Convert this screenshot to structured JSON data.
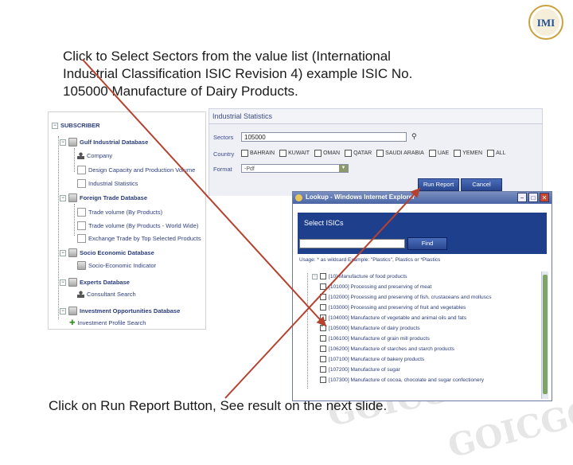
{
  "logo": {
    "text": "IMI"
  },
  "instructions": {
    "top": "Click to Select Sectors from the value list (International Industrial Classification ISIC Revision 4) example ISIC No. 105000 Manufacture of Dairy Products.",
    "bottom": "Click on Run Report Button,  See result on the next slide."
  },
  "watermark": {
    "text": "GOICGOICG"
  },
  "left_panel": {
    "subscriber": "SUBSCRIBER",
    "gulf_industrial": "Gulf Industrial Database",
    "company": "Company",
    "design_capacity": "Design Capacity and Production Volume",
    "industrial_statistics": "Industrial Statistics",
    "foreign_trade": "Foreign Trade Database",
    "trade_volume_products": "Trade volume (By Products)",
    "trade_volume_worldwide": "Trade volume (By Products - World Wide)",
    "exchange_trade": "Exchange Trade by Top Selected Products",
    "socio_economic": "Socio Economic Database",
    "socio_indicator": "Socio-Economic Indicator",
    "experts": "Experts Database",
    "consultant_search": "Consultant Search",
    "investment": "Investment Opportunities Database",
    "investment_profile": "Investment Profile Search"
  },
  "main_panel": {
    "title": "Industrial Statistics",
    "sectors_label": "Sectors",
    "sectors_value": "105000",
    "country_label": "Country",
    "countries": [
      "BAHRAIN",
      "KUWAIT",
      "OMAN",
      "QATAR",
      "SAUDI ARABIA",
      "UAE",
      "YEMEN",
      "ALL"
    ],
    "format_label": "Format",
    "format_value": "-Pdf",
    "run_report": "Run Report",
    "cancel": "Cancel"
  },
  "lookup": {
    "window_title": "Lookup - Windows Internet Explorer",
    "header_title": "Select ISICs",
    "find": "Find",
    "usage": "Usage: * as wildcard  Example: \"Plastics\", Plastics or *Plastics",
    "items": [
      {
        "label": "[10] Manufacture of food products",
        "checked": false
      },
      {
        "label": "[101000] Processing and preserving of meat",
        "checked": false
      },
      {
        "label": "[102000] Processing and preserving of fish, crustaceans and molluscs",
        "checked": false
      },
      {
        "label": "[103000] Processing and preserving of fruit and vegetables",
        "checked": false
      },
      {
        "label": "[104000] Manufacture of vegetable and animal oils and fats",
        "checked": false
      },
      {
        "label": "[105000] Manufacture of dairy products",
        "checked": true
      },
      {
        "label": "[106100] Manufacture of grain mill products",
        "checked": false
      },
      {
        "label": "[106200] Manufacture of starches and starch products",
        "checked": false
      },
      {
        "label": "[107100] Manufacture of bakery products",
        "checked": false
      },
      {
        "label": "[107200] Manufacture of sugar",
        "checked": false
      },
      {
        "label": "[107300] Manufacture of cocoa, chocolate and sugar confectionery",
        "checked": false
      }
    ]
  },
  "colors": {
    "arrow": "#b5412f",
    "header_navy": "#1e3f8c",
    "button_blue": "#2f4f9a"
  }
}
